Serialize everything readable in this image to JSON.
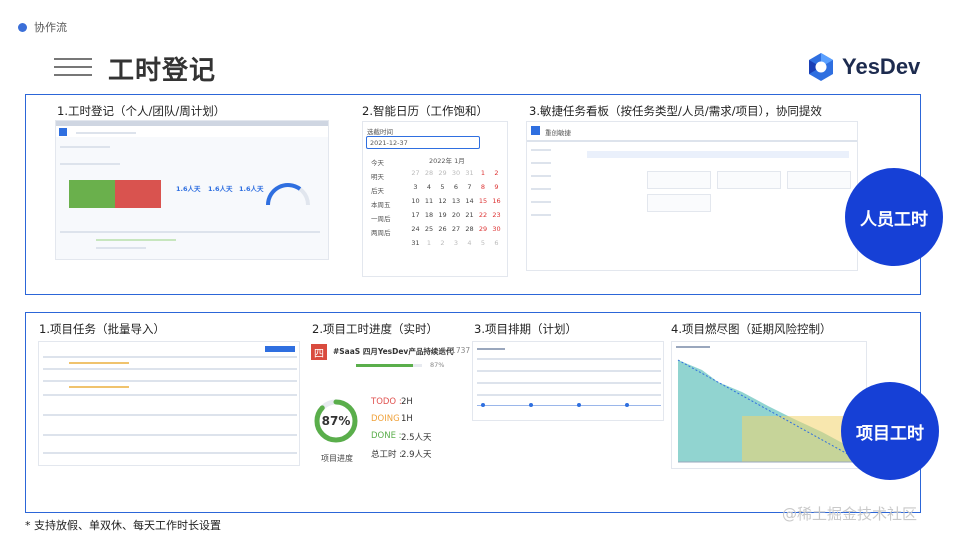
{
  "header": {
    "tag": "协作流",
    "title": "工时登记",
    "logo_text": "YesDev"
  },
  "colors": {
    "primary": "#1640d6",
    "border": "#2c66d8",
    "green": "#6ab04c",
    "red": "#d9534f"
  },
  "panel_top": {
    "sections": [
      {
        "label": "1.工时登记（个人/团队/周计划）"
      },
      {
        "label": "2.智能日历（工作饱和）"
      },
      {
        "label": "3.敏捷任务看板（按任务类型/人员/需求/项目），协同提效"
      }
    ],
    "badge": "人员工时",
    "shot1": {
      "stat1": "1.6人天",
      "stat2": "1.6人天",
      "stat3": "1.6人天"
    },
    "shot2": {
      "header": "选截时间",
      "date_input": "2021-12-37",
      "quick_options": [
        "今天",
        "明天",
        "后天",
        "本周五",
        "一周后",
        "两周后"
      ],
      "month": "2022年 1月",
      "weeks": [
        [
          "27",
          "28",
          "29",
          "30",
          "31",
          "1",
          "2"
        ],
        [
          "3",
          "4",
          "5",
          "6",
          "7",
          "8",
          "9"
        ],
        [
          "10",
          "11",
          "12",
          "13",
          "14",
          "15",
          "16"
        ],
        [
          "17",
          "18",
          "19",
          "20",
          "21",
          "22",
          "23"
        ],
        [
          "24",
          "25",
          "26",
          "27",
          "28",
          "29",
          "30"
        ],
        [
          "31",
          "1",
          "2",
          "3",
          "4",
          "5",
          "6"
        ]
      ]
    },
    "shot3": {
      "app_name": "重创敏捷"
    }
  },
  "panel_bottom": {
    "sections": [
      {
        "label": "1.项目任务（批量导入）"
      },
      {
        "label": "2.项目工时进度（实时）"
      },
      {
        "label": "3.项目排期（计划）"
      },
      {
        "label": "4.项目燃尽图（延期风险控制）"
      }
    ],
    "badge": "项目工时",
    "progress": {
      "icon_char": "四",
      "project_name": "#SaaS 四月YesDev产品持续迭代",
      "project_id": "#31737",
      "percent_label": "87%",
      "percent_value": 87,
      "caption": "项目进度",
      "bar_percent_label": "87%",
      "rows": [
        {
          "key": "TODO :",
          "value": "2H",
          "color": "#e0524f"
        },
        {
          "key": "DOING :",
          "value": "1H",
          "color": "#f0a23b"
        },
        {
          "key": "DONE :",
          "value": "2.5人天",
          "color": "#5aae4b"
        },
        {
          "key": "总工时 :",
          "value": "2.9人天",
          "color": "#333333"
        }
      ]
    }
  },
  "footnote": "* 支持放假、单双休、每天工作时长设置",
  "watermark": "@稀土掘金技术社区"
}
